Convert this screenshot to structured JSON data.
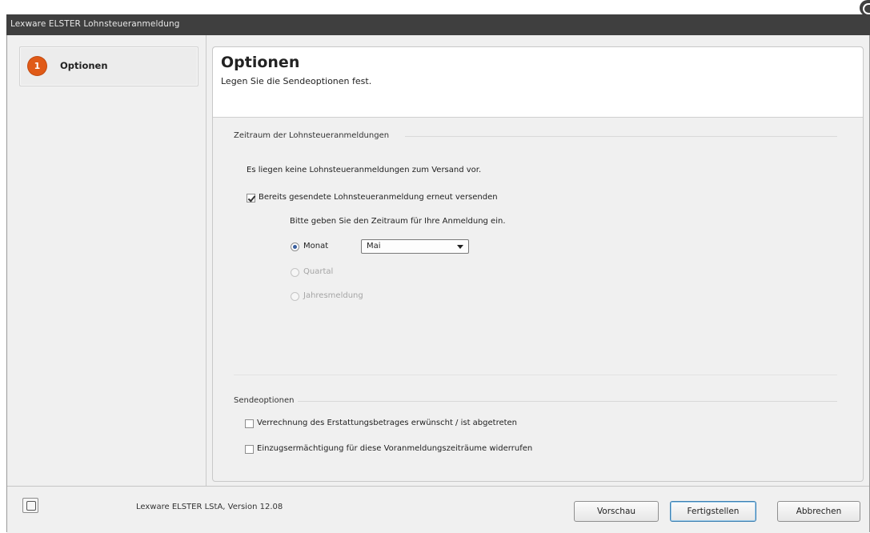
{
  "window": {
    "title": "Lexware ELSTER Lohnsteueranmeldung"
  },
  "sidebar": {
    "steps": [
      {
        "number": "1",
        "label": "Optionen"
      }
    ]
  },
  "header": {
    "title": "Optionen",
    "subtitle": "Legen Sie die Sendeoptionen fest."
  },
  "period_group": {
    "title": "Zeitraum der Lohnsteueranmeldungen",
    "info": "Es liegen keine Lohnsteueranmeldungen zum Versand vor.",
    "resend_checkbox": {
      "label": "Bereits gesendete Lohnsteueranmeldung erneut versenden",
      "checked": true
    },
    "prompt": "Bitte geben Sie den Zeitraum für Ihre Anmeldung ein.",
    "radios": [
      {
        "label": "Monat",
        "selected": true,
        "enabled": true
      },
      {
        "label": "Quartal",
        "selected": false,
        "enabled": false
      },
      {
        "label": "Jahresmeldung",
        "selected": false,
        "enabled": false
      }
    ],
    "month_select": {
      "value": "Mai"
    }
  },
  "send_group": {
    "title": "Sendeoptionen",
    "checkboxes": [
      {
        "label": "Verrechnung des Erstattungsbetrages erwünscht / ist abgetreten",
        "checked": false
      },
      {
        "label": "Einzugsermächtigung für diese Voranmeldungszeiträume widerrufen",
        "checked": false
      }
    ]
  },
  "footer": {
    "help_icon": "help-book-icon",
    "version_text": "Lexware ELSTER LStA, Version 12.08",
    "buttons": {
      "preview": "Vorschau",
      "finish": "Fertigstellen",
      "cancel": "Abbrechen"
    }
  },
  "colors": {
    "titlebar": "#3f3f3f",
    "step_badge": "#e05a17",
    "default_button_border": "#3c7fb1"
  }
}
